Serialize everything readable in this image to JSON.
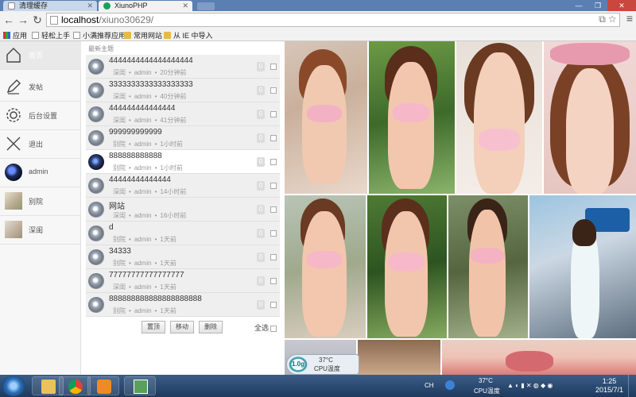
{
  "browser": {
    "tabs": [
      {
        "label": "清理缓存",
        "active": false
      },
      {
        "label": "XiunoPHP",
        "active": true
      }
    ],
    "url_host": "localhost",
    "url_path": "/xiuno30629/",
    "bookmarks": [
      "应用",
      "轻松上手",
      "小满推荐应用",
      "常用网站",
      "从 IE 中导入"
    ]
  },
  "sidebar": {
    "items": [
      {
        "label": "首页",
        "icon": "home-icon"
      },
      {
        "label": "发帖",
        "icon": "edit-icon"
      },
      {
        "label": "后台设置",
        "icon": "gear-icon"
      },
      {
        "label": "退出",
        "icon": "close-icon"
      },
      {
        "label": "admin",
        "icon": "avatar"
      },
      {
        "label": "别院",
        "icon": "forum-thumb"
      },
      {
        "label": "深闺",
        "icon": "forum-thumb"
      }
    ]
  },
  "threads": {
    "header": "最新主题",
    "rows": [
      {
        "title": "4444444444444444444",
        "forum": "深闺",
        "author": "admin",
        "time": "20分钟前",
        "count": "0"
      },
      {
        "title": "3333333333333333333",
        "forum": "深闺",
        "author": "admin",
        "time": "40分钟前",
        "count": "0"
      },
      {
        "title": "444444444444444",
        "forum": "深闺",
        "author": "admin",
        "time": "41分钟前",
        "count": "0"
      },
      {
        "title": "999999999999",
        "forum": "别院",
        "author": "admin",
        "time": "1小时前",
        "count": "0"
      },
      {
        "title": "888888888888",
        "forum": "别院",
        "author": "admin",
        "time": "1小时前",
        "count": "0"
      },
      {
        "title": "44444444444444",
        "forum": "深闺",
        "author": "admin",
        "time": "14小时前",
        "count": "0"
      },
      {
        "title": "网站",
        "forum": "深闺",
        "author": "admin",
        "time": "16小时前",
        "count": "0"
      },
      {
        "title": "d",
        "forum": "别院",
        "author": "admin",
        "time": "1天前",
        "count": "0"
      },
      {
        "title": "34333",
        "forum": "别院",
        "author": "admin",
        "time": "1天前",
        "count": "0"
      },
      {
        "title": "77777777777777777",
        "forum": "深闺",
        "author": "admin",
        "time": "1天前",
        "count": "0"
      },
      {
        "title": "888888888888888888888",
        "forum": "别院",
        "author": "admin",
        "time": "1天前",
        "count": "0"
      }
    ],
    "actions": [
      "置顶",
      "移动",
      "删除"
    ],
    "select_all": "全选"
  },
  "widget": {
    "gauge": "1.0g",
    "temp": "37°C",
    "cpu": "CPU温度"
  },
  "taskbar": {
    "tray_ch": "CH",
    "tray_temp": "37°C",
    "tray_cpu": "CPU温度",
    "time": "1:25",
    "date": "2015/7/1"
  }
}
